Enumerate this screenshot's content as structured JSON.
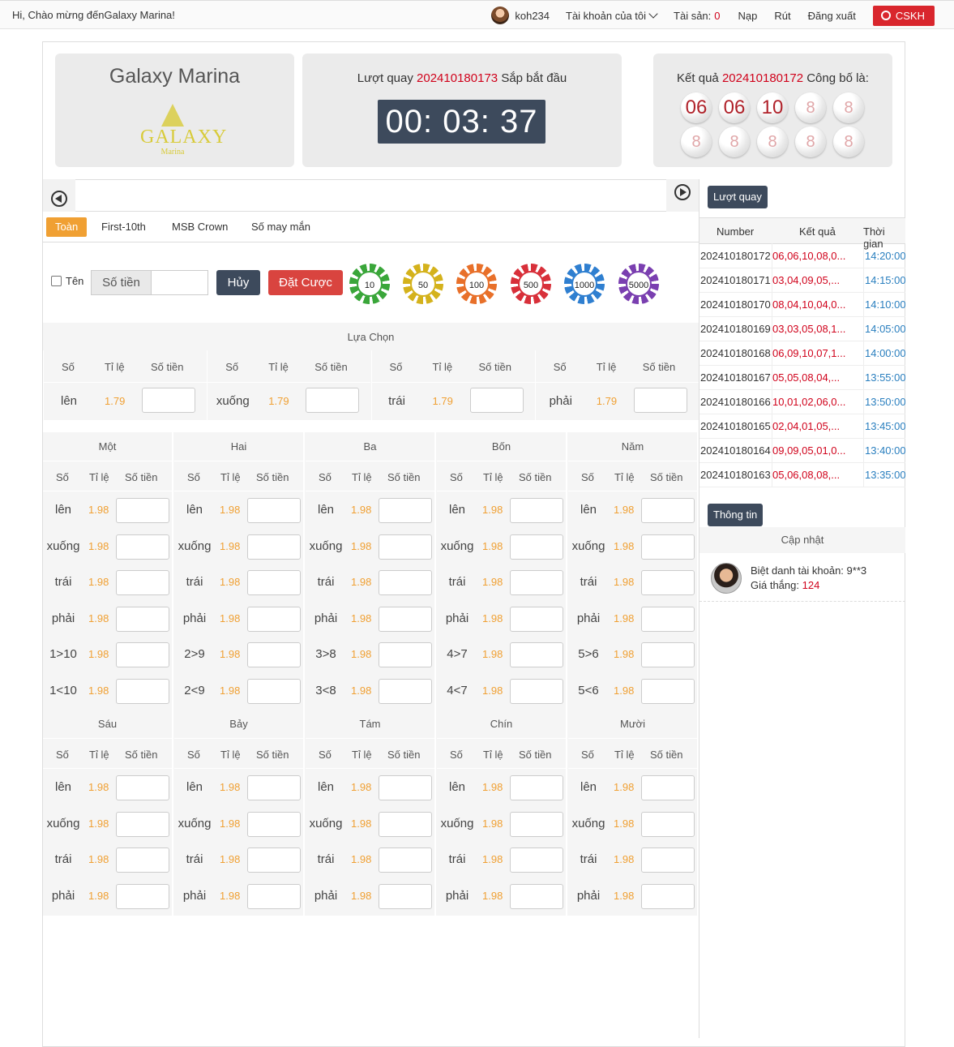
{
  "topbar": {
    "greeting": "Hi,  Chào mừng đếnGalaxy Marina!",
    "username": "koh234",
    "account_menu": "Tài khoản của tôi",
    "assets_label": "Tài sản:",
    "assets_value": "0",
    "deposit": "Nạp",
    "withdraw": "Rút",
    "logout": "Đăng xuất",
    "support": "CSKH"
  },
  "brand": {
    "title": "Galaxy Marina",
    "logo_word": "GALAXY",
    "logo_sub": "Marina"
  },
  "round": {
    "label": "Lượt quay",
    "id": "202410180173",
    "status": "Sắp bắt đầu",
    "countdown": "00: 03: 37"
  },
  "result": {
    "label": "Kết quả",
    "id": "202410180172",
    "suffix": "Công bố là:",
    "balls": [
      "06",
      "06",
      "10",
      "8",
      "8",
      "8",
      "8",
      "8",
      "8",
      "8"
    ]
  },
  "tabs": [
    "Toàn",
    "First-10th",
    "MSB Crown",
    "Số may mắn"
  ],
  "controls": {
    "name_checkbox": "Tên",
    "amount_label": "Số tiền",
    "amount_value": "",
    "cancel": "Hủy",
    "place_bet": "Đặt Cược",
    "chips": [
      {
        "value": "10",
        "color": "#3aa63a"
      },
      {
        "value": "50",
        "color": "#d4b21c"
      },
      {
        "value": "100",
        "color": "#e8702a"
      },
      {
        "value": "500",
        "color": "#d8303a"
      },
      {
        "value": "1000",
        "color": "#2f7fd0"
      },
      {
        "value": "5000",
        "color": "#7a3fb0"
      }
    ]
  },
  "choice": {
    "title": "Lựa Chọn",
    "headers": [
      "Số",
      "Tỉ lệ",
      "Số tiền"
    ],
    "items": [
      {
        "label": "lên",
        "odds": "1.79"
      },
      {
        "label": "xuống",
        "odds": "1.79"
      },
      {
        "label": "trái",
        "odds": "1.79"
      },
      {
        "label": "phải",
        "odds": "1.79"
      }
    ]
  },
  "grid_headers": [
    "Số",
    "Tỉ lệ",
    "Số tiền"
  ],
  "grid_top": [
    {
      "title": "Một",
      "rows": [
        [
          "lên",
          "1.98"
        ],
        [
          "xuống",
          "1.98"
        ],
        [
          "trái",
          "1.98"
        ],
        [
          "phải",
          "1.98"
        ],
        [
          "1>10",
          "1.98"
        ],
        [
          "1<10",
          "1.98"
        ]
      ]
    },
    {
      "title": "Hai",
      "rows": [
        [
          "lên",
          "1.98"
        ],
        [
          "xuống",
          "1.98"
        ],
        [
          "trái",
          "1.98"
        ],
        [
          "phải",
          "1.98"
        ],
        [
          "2>9",
          "1.98"
        ],
        [
          "2<9",
          "1.98"
        ]
      ]
    },
    {
      "title": "Ba",
      "rows": [
        [
          "lên",
          "1.98"
        ],
        [
          "xuống",
          "1.98"
        ],
        [
          "trái",
          "1.98"
        ],
        [
          "phải",
          "1.98"
        ],
        [
          "3>8",
          "1.98"
        ],
        [
          "3<8",
          "1.98"
        ]
      ]
    },
    {
      "title": "Bốn",
      "rows": [
        [
          "lên",
          "1.98"
        ],
        [
          "xuống",
          "1.98"
        ],
        [
          "trái",
          "1.98"
        ],
        [
          "phải",
          "1.98"
        ],
        [
          "4>7",
          "1.98"
        ],
        [
          "4<7",
          "1.98"
        ]
      ]
    },
    {
      "title": "Năm",
      "rows": [
        [
          "lên",
          "1.98"
        ],
        [
          "xuống",
          "1.98"
        ],
        [
          "trái",
          "1.98"
        ],
        [
          "phải",
          "1.98"
        ],
        [
          "5>6",
          "1.98"
        ],
        [
          "5<6",
          "1.98"
        ]
      ]
    }
  ],
  "grid_bottom": [
    {
      "title": "Sáu",
      "rows": [
        [
          "lên",
          "1.98"
        ],
        [
          "xuống",
          "1.98"
        ],
        [
          "trái",
          "1.98"
        ],
        [
          "phải",
          "1.98"
        ]
      ]
    },
    {
      "title": "Bảy",
      "rows": [
        [
          "lên",
          "1.98"
        ],
        [
          "xuống",
          "1.98"
        ],
        [
          "trái",
          "1.98"
        ],
        [
          "phải",
          "1.98"
        ]
      ]
    },
    {
      "title": "Tám",
      "rows": [
        [
          "lên",
          "1.98"
        ],
        [
          "xuống",
          "1.98"
        ],
        [
          "trái",
          "1.98"
        ],
        [
          "phải",
          "1.98"
        ]
      ]
    },
    {
      "title": "Chín",
      "rows": [
        [
          "lên",
          "1.98"
        ],
        [
          "xuống",
          "1.98"
        ],
        [
          "trái",
          "1.98"
        ],
        [
          "phải",
          "1.98"
        ]
      ]
    },
    {
      "title": "Mười",
      "rows": [
        [
          "lên",
          "1.98"
        ],
        [
          "xuống",
          "1.98"
        ],
        [
          "trái",
          "1.98"
        ],
        [
          "phải",
          "1.98"
        ]
      ]
    }
  ],
  "history": {
    "title": "Lượt quay",
    "columns": [
      "Number",
      "Kết quả",
      "Thời gian"
    ],
    "rows": [
      [
        "202410180172",
        "06,06,10,08,0...",
        "14:20:00"
      ],
      [
        "202410180171",
        "03,04,09,05,...",
        "14:15:00"
      ],
      [
        "202410180170",
        "08,04,10,04,0...",
        "14:10:00"
      ],
      [
        "202410180169",
        "03,03,05,08,1...",
        "14:05:00"
      ],
      [
        "202410180168",
        "06,09,10,07,1...",
        "14:00:00"
      ],
      [
        "202410180167",
        "05,05,08,04,...",
        "13:55:00"
      ],
      [
        "202410180166",
        "10,01,02,06,0...",
        "13:50:00"
      ],
      [
        "202410180165",
        "02,04,01,05,...",
        "13:45:00"
      ],
      [
        "202410180164",
        "09,09,05,01,0...",
        "13:40:00"
      ],
      [
        "202410180163",
        "05,06,08,08,...",
        "13:35:00"
      ]
    ]
  },
  "info": {
    "title": "Thông tin",
    "update_label": "Cập nhật",
    "nickname": "Biệt danh tài khoản: 9**3",
    "win_label": "Giá thắng:",
    "win_value": "124"
  }
}
